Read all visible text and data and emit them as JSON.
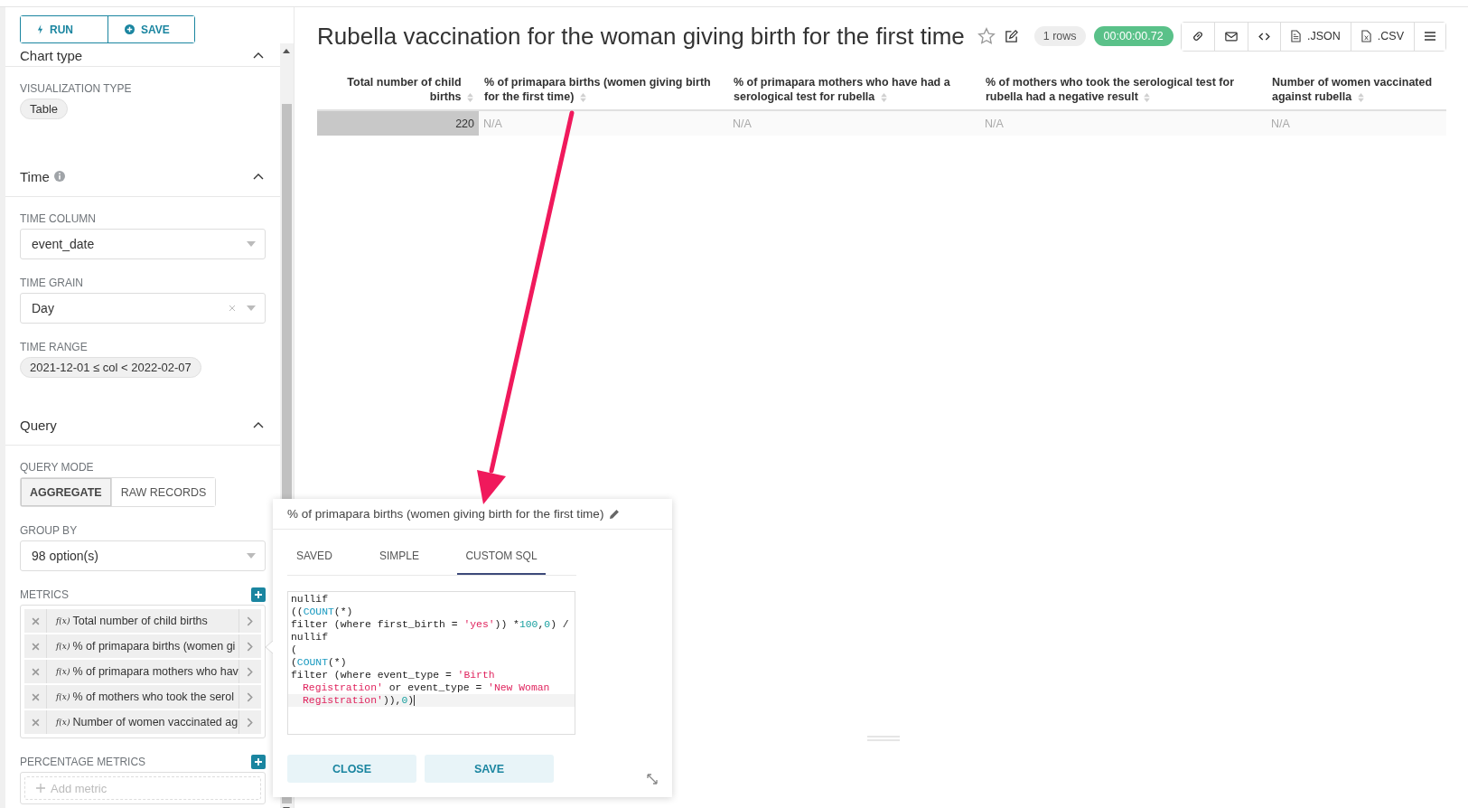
{
  "toolbar": {
    "buttons": [
      {
        "label": "RUN",
        "kind": "run"
      },
      {
        "label": "SAVE",
        "kind": "save"
      }
    ]
  },
  "sidebar": {
    "sections": [
      {
        "title": "Chart type",
        "info": false,
        "expanded": true,
        "controls": [
          {
            "kind": "pill",
            "label": "VISUALIZATION TYPE",
            "value": "Table"
          }
        ]
      },
      {
        "title": "Time",
        "info": true,
        "expanded": true,
        "controls": [
          {
            "kind": "select",
            "label": "TIME COLUMN",
            "value": "event_date",
            "clearable": false
          },
          {
            "kind": "select",
            "label": "TIME GRAIN",
            "value": "Day",
            "clearable": true
          },
          {
            "kind": "pill",
            "label": "TIME RANGE",
            "value": "2021-12-01 ≤ col < 2022-02-07"
          }
        ]
      },
      {
        "title": "Query",
        "info": false,
        "expanded": true,
        "controls": [
          {
            "kind": "toggle",
            "label": "QUERY MODE",
            "options": [
              {
                "label": "AGGREGATE",
                "selected": true
              },
              {
                "label": "RAW RECORDS",
                "selected": false
              }
            ]
          },
          {
            "kind": "select",
            "label": "GROUP BY",
            "value": "98 option(s)",
            "clearable": false
          },
          {
            "kind": "metrics",
            "label": "METRICS",
            "items": [
              {
                "fx": "f(x)",
                "label": "Total number of child births"
              },
              {
                "fx": "f(x)",
                "label": "% of primapara births (women gi"
              },
              {
                "fx": "f(x)",
                "label": "% of primapara mothers who hav"
              },
              {
                "fx": "f(x)",
                "label": "% of mothers who took the serol"
              },
              {
                "fx": "f(x)",
                "label": "Number of women vaccinated ag"
              }
            ]
          },
          {
            "kind": "metrics",
            "label": "PERCENTAGE METRICS",
            "placeholder": "Add metric"
          }
        ]
      }
    ]
  },
  "chart": {
    "title": "Rubella vaccination for the woman giving birth for the first time",
    "starred": false,
    "rows_badge": "1 rows",
    "timer": {
      "text": "00:00:00.72",
      "color": "#5ac189"
    },
    "actions": [
      {
        "kind": "link"
      },
      {
        "kind": "mail"
      },
      {
        "kind": "code"
      },
      {
        "kind": "file",
        "label": ".JSON"
      },
      {
        "kind": "sheet",
        "label": ".CSV"
      },
      {
        "kind": "menu"
      }
    ],
    "table": {
      "columns": [
        {
          "label": "Total number of child births",
          "kind": "number"
        },
        {
          "label": "% of primapara births (women giving birth for the first time)",
          "kind": "text"
        },
        {
          "label": "% of primapara mothers who have had a serological test for rubella",
          "kind": "text"
        },
        {
          "label": "% of mothers who took the serological test for rubella had a negative result",
          "kind": "text"
        },
        {
          "label": "Number of women vaccinated against rubella",
          "kind": "text"
        }
      ],
      "rows": [
        {
          "cells": [
            {
              "text": "220",
              "level": 1
            },
            {
              "text": "N/A"
            },
            {
              "text": "N/A"
            },
            {
              "text": "N/A"
            },
            {
              "text": "N/A"
            }
          ]
        }
      ]
    }
  },
  "popover": {
    "title": "% of primapara births (women giving birth for the first time)",
    "tabs": [
      {
        "label": "SAVED",
        "selected": false
      },
      {
        "label": "SIMPLE",
        "selected": false
      },
      {
        "label": "CUSTOM SQL",
        "selected": true
      }
    ],
    "code": [
      {
        "continued": false,
        "active": false,
        "tokens": [
          {
            "kind": "plain",
            "text": "nullif"
          }
        ]
      },
      {
        "continued": false,
        "active": false,
        "tokens": [
          {
            "kind": "plain",
            "text": "(("
          },
          {
            "kind": "keyword",
            "text": "COUNT"
          },
          {
            "kind": "plain",
            "text": "(*)"
          }
        ]
      },
      {
        "continued": false,
        "active": false,
        "tokens": [
          {
            "kind": "plain",
            "text": "filter (where first_birth = "
          },
          {
            "kind": "string",
            "text": "'yes'"
          },
          {
            "kind": "plain",
            "text": ")) *"
          },
          {
            "kind": "number",
            "text": "100"
          },
          {
            "kind": "plain",
            "text": ","
          },
          {
            "kind": "number",
            "text": "0"
          },
          {
            "kind": "plain",
            "text": ") /"
          }
        ]
      },
      {
        "continued": false,
        "active": false,
        "tokens": [
          {
            "kind": "plain",
            "text": "nullif"
          }
        ]
      },
      {
        "continued": false,
        "active": false,
        "tokens": [
          {
            "kind": "plain",
            "text": "("
          }
        ]
      },
      {
        "continued": false,
        "active": false,
        "tokens": [
          {
            "kind": "plain",
            "text": "("
          },
          {
            "kind": "keyword",
            "text": "COUNT"
          },
          {
            "kind": "plain",
            "text": "(*)"
          }
        ]
      },
      {
        "continued": false,
        "active": false,
        "tokens": [
          {
            "kind": "plain",
            "text": "filter (where event_type = "
          },
          {
            "kind": "string",
            "text": "'Birth"
          }
        ]
      },
      {
        "continued": true,
        "active": false,
        "tokens": [
          {
            "kind": "string",
            "text": "Registration'"
          },
          {
            "kind": "plain",
            "text": " or event_type = "
          },
          {
            "kind": "string",
            "text": "'New Woman"
          }
        ]
      },
      {
        "continued": true,
        "active": true,
        "tokens": [
          {
            "kind": "string",
            "text": "Registration'"
          },
          {
            "kind": "plain",
            "text": ")),"
          },
          {
            "kind": "number",
            "text": "0"
          },
          {
            "kind": "plain",
            "text": ")"
          }
        ]
      }
    ],
    "buttons": [
      {
        "label": "CLOSE"
      },
      {
        "label": "SAVE"
      }
    ]
  }
}
